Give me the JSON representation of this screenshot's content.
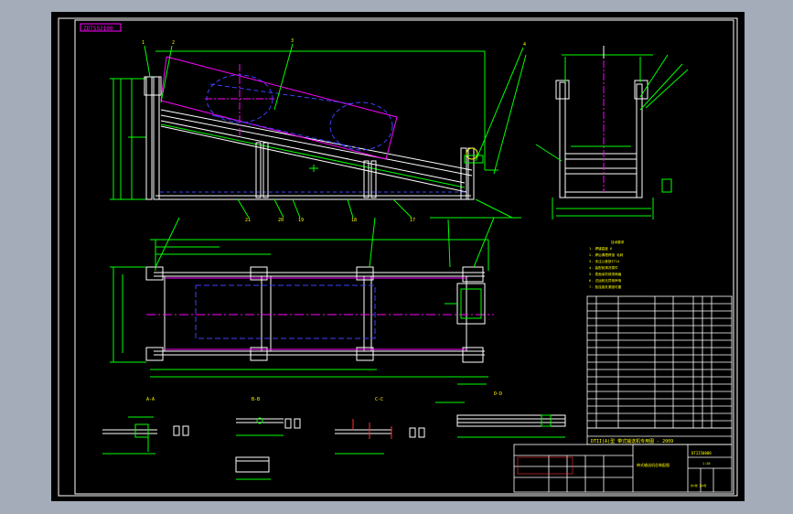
{
  "app": {
    "viewport_bg": "#a3acb8",
    "sheet_bg": "#000000"
  },
  "colors": {
    "frame": "#ffffff",
    "geometry": "#ffffff",
    "dimension": "#00ff00",
    "centerline": "#ff00ff",
    "hidden": "#4040ff",
    "text": "#ffff00",
    "accent_red": "#ff3030",
    "title_tag": "#ff00ff"
  },
  "drawing": {
    "tag": "ZDTS52100",
    "views": {
      "front": "front-elevation",
      "side": "side-elevation",
      "plan": "plan-view"
    },
    "section_labels": [
      "A-A",
      "B-B",
      "C-C",
      "D-D"
    ]
  },
  "notes": {
    "heading": "技术要求",
    "lines": [
      "1. 焊缝高度 6",
      "2. 焊后清理焊渣 毛刺",
      "3. 未注公差按IT14",
      "4. 装配前清洗零件",
      "5. 表面涂防锈漆两遍",
      "6. 试运转无异常声响",
      "7. 各连接处紧固可靠"
    ]
  },
  "title_block": {
    "title": "DTII(A)型 带式输送机专用图 - 2009",
    "drawing_no": "DTII50008",
    "project": "带式输送机总装配图",
    "scale": "1:20",
    "sheet": "共1张 第1张"
  }
}
